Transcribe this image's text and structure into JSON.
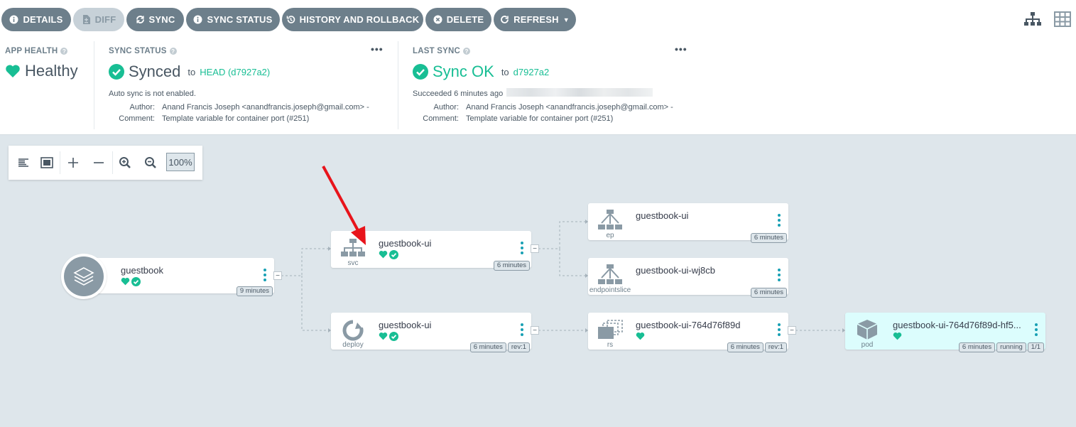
{
  "toolbar": {
    "buttons": [
      {
        "label": "DETAILS",
        "icon": "info-icon"
      },
      {
        "label": "DIFF",
        "icon": "file-diff-icon"
      },
      {
        "label": "SYNC",
        "icon": "sync-icon"
      },
      {
        "label": "SYNC STATUS",
        "icon": "info-icon"
      },
      {
        "label": "HISTORY AND ROLLBACK",
        "icon": "history-icon"
      },
      {
        "label": "DELETE",
        "icon": "close-circle-icon"
      },
      {
        "label": "REFRESH",
        "icon": "refresh-icon"
      }
    ]
  },
  "status": {
    "app_health": {
      "label": "APP HEALTH",
      "value": "Healthy"
    },
    "sync_status": {
      "label": "SYNC STATUS",
      "value": "Synced",
      "to": "to",
      "revision": "HEAD (d7927a2)",
      "auto_sync": "Auto sync is not enabled.",
      "author_label": "Author:",
      "author": "Anand Francis Joseph <anandfrancis.joseph@gmail.com> -",
      "comment_label": "Comment:",
      "comment": "Template variable for container port (#251)"
    },
    "last_sync": {
      "label": "LAST SYNC",
      "value": "Sync OK",
      "to": "to",
      "revision": "d7927a2",
      "succeeded": "Succeeded 6 minutes ago",
      "author_label": "Author:",
      "author": "Anand Francis Joseph <anandfrancis.joseph@gmail.com> -",
      "comment_label": "Comment:",
      "comment": "Template variable for container port (#251)"
    },
    "more": "•••"
  },
  "zoom": {
    "level": "100%"
  },
  "nodes": {
    "app": {
      "name": "guestbook",
      "age": "9 minutes"
    },
    "svc": {
      "name": "guestbook-ui",
      "kind": "svc",
      "age": "6 minutes"
    },
    "ep": {
      "name": "guestbook-ui",
      "kind": "ep",
      "age": "6 minutes"
    },
    "endpointslice": {
      "name": "guestbook-ui-wj8cb",
      "kind": "endpointslice",
      "age": "6 minutes"
    },
    "deploy": {
      "name": "guestbook-ui",
      "kind": "deploy",
      "age": "6 minutes",
      "rev": "rev:1"
    },
    "rs": {
      "name": "guestbook-ui-764d76f89d",
      "kind": "rs",
      "age": "6 minutes",
      "rev": "rev:1"
    },
    "pod": {
      "name": "guestbook-ui-764d76f89d-hf5...",
      "kind": "pod",
      "age": "6 minutes",
      "state": "running",
      "ready": "1/1"
    }
  },
  "colors": {
    "accent": "#18be94",
    "button": "#6d7f8b",
    "kebab": "#18a0b4",
    "arrow": "#e8141b",
    "canvas": "#dee6eb"
  }
}
